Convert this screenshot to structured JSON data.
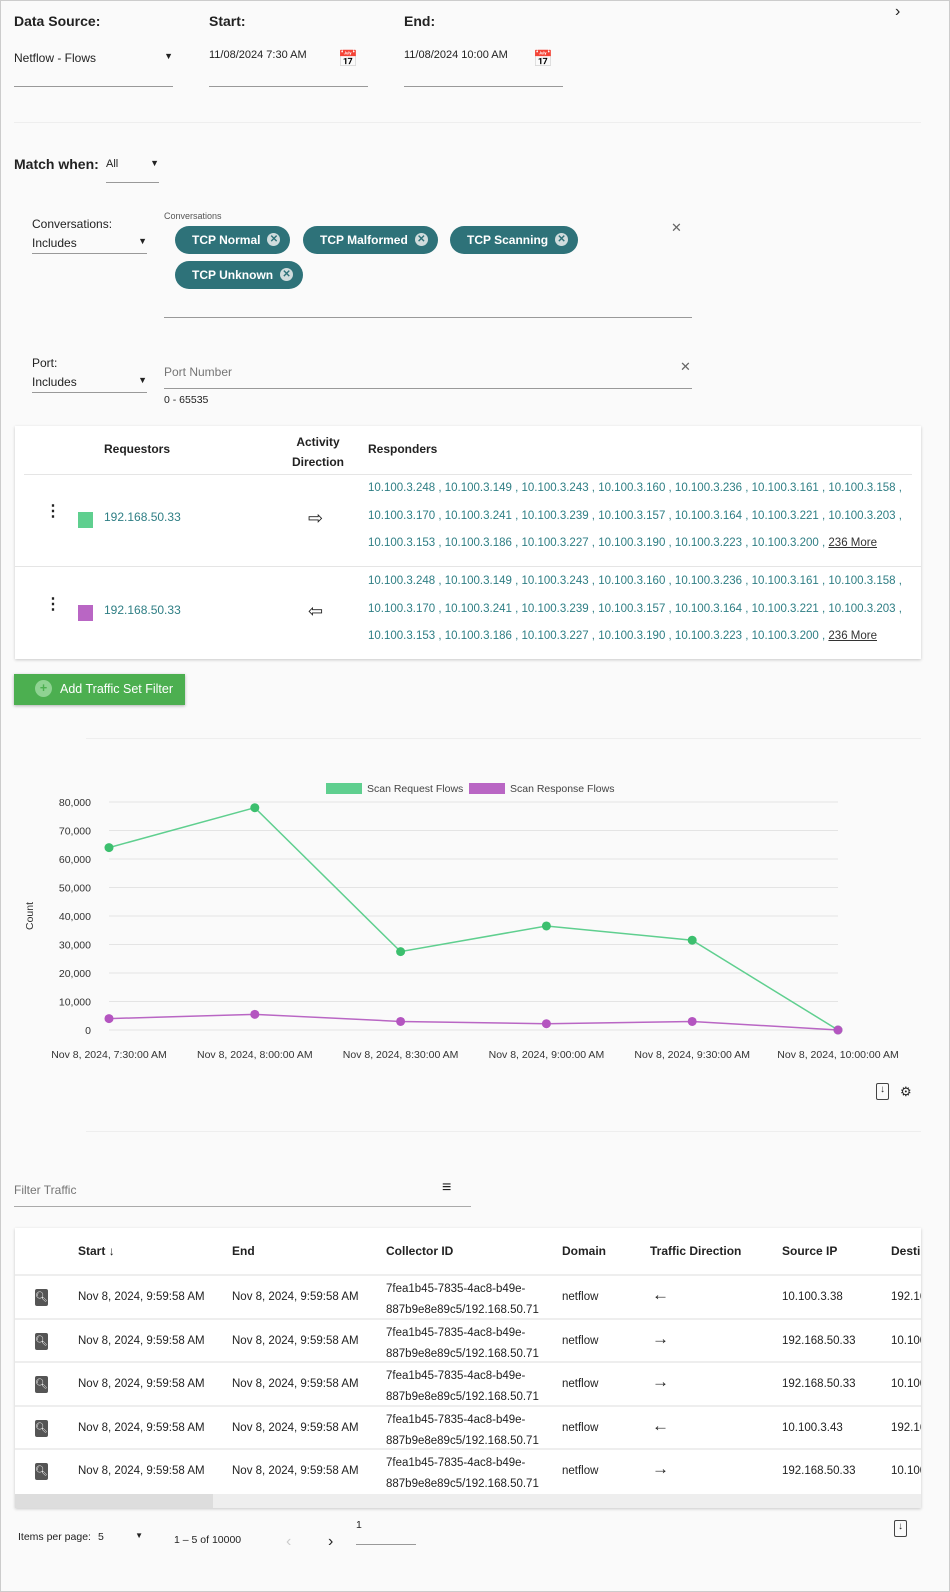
{
  "filters": {
    "data_source_label": "Data Source:",
    "data_source": "Netflow - Flows",
    "start_label": "Start:",
    "start": "11/08/2024 7:30 AM",
    "end_label": "End:",
    "end": "11/08/2024 10:00 AM",
    "match_label": "Match when:",
    "match": "All"
  },
  "conversations": {
    "label": "Conversations:",
    "mode": "Includes",
    "field_label": "Conversations",
    "chips": [
      "TCP Normal",
      "TCP Malformed",
      "TCP Scanning",
      "TCP Unknown"
    ]
  },
  "port": {
    "label": "Port:",
    "mode": "Includes",
    "placeholder": "Port Number",
    "hint": "0 - 65535"
  },
  "traffic_sets": {
    "headers": {
      "requestors": "Requestors",
      "activity1": "Activity",
      "activity2": "Direction",
      "responders": "Responders"
    },
    "rows": [
      {
        "requestor": "192.168.50.33",
        "color": "#5fcf8f",
        "direction": "right",
        "responders": "10.100.3.248 , 10.100.3.149 , 10.100.3.243 , 10.100.3.160 , 10.100.3.236 , 10.100.3.161 , 10.100.3.158 , 10.100.3.170 , 10.100.3.241 , 10.100.3.239 , 10.100.3.157 , 10.100.3.164 , 10.100.3.221 , 10.100.3.203 , 10.100.3.153 , 10.100.3.186 , 10.100.3.227 , 10.100.3.190 , 10.100.3.223 , 10.100.3.200 ,",
        "more": "236 More"
      },
      {
        "requestor": "192.168.50.33",
        "color": "#b966c4",
        "direction": "left",
        "responders": "10.100.3.248 , 10.100.3.149 , 10.100.3.243 , 10.100.3.160 , 10.100.3.236 , 10.100.3.161 , 10.100.3.158 , 10.100.3.170 , 10.100.3.241 , 10.100.3.239 , 10.100.3.157 , 10.100.3.164 , 10.100.3.221 , 10.100.3.203 , 10.100.3.153 , 10.100.3.186 , 10.100.3.227 , 10.100.3.190 , 10.100.3.223 , 10.100.3.200 ,",
        "more": "236 More"
      }
    ],
    "add_button": "Add Traffic Set Filter"
  },
  "chart_data": {
    "type": "line",
    "ylabel": "Count",
    "ylim": [
      0,
      80000
    ],
    "yticks": [
      "0",
      "10,000",
      "20,000",
      "30,000",
      "40,000",
      "50,000",
      "60,000",
      "70,000",
      "80,000"
    ],
    "categories": [
      "Nov 8, 2024, 7:30:00 AM",
      "Nov 8, 2024, 8:00:00 AM",
      "Nov 8, 2024, 8:30:00 AM",
      "Nov 8, 2024, 9:00:00 AM",
      "Nov 8, 2024, 9:30:00 AM",
      "Nov 8, 2024, 10:00:00 AM"
    ],
    "legend": "top",
    "grid": true,
    "series": [
      {
        "name": "Scan Request Flows",
        "color": "#5fcf8f",
        "values": [
          64000,
          78000,
          27500,
          36500,
          31500,
          0
        ]
      },
      {
        "name": "Scan Response Flows",
        "color": "#b966c4",
        "values": [
          4000,
          5500,
          3000,
          2200,
          3000,
          0
        ]
      }
    ]
  },
  "table": {
    "filter_placeholder": "Filter Traffic",
    "headers": [
      "Start",
      "End",
      "Collector ID",
      "Domain",
      "Traffic Direction",
      "Source IP",
      "Desti"
    ],
    "rows": [
      {
        "start": "Nov 8, 2024, 9:59:58 AM",
        "end": "Nov 8, 2024, 9:59:58 AM",
        "c1": "7fea1b45-7835-4ac8-b49e-",
        "c2": "887b9e8e89c5/192.168.50.71",
        "domain": "netflow",
        "dir": "←",
        "src": "10.100.3.38",
        "dst": "192.16"
      },
      {
        "start": "Nov 8, 2024, 9:59:58 AM",
        "end": "Nov 8, 2024, 9:59:58 AM",
        "c1": "7fea1b45-7835-4ac8-b49e-",
        "c2": "887b9e8e89c5/192.168.50.71",
        "domain": "netflow",
        "dir": "→",
        "src": "192.168.50.33",
        "dst": "10.100"
      },
      {
        "start": "Nov 8, 2024, 9:59:58 AM",
        "end": "Nov 8, 2024, 9:59:58 AM",
        "c1": "7fea1b45-7835-4ac8-b49e-",
        "c2": "887b9e8e89c5/192.168.50.71",
        "domain": "netflow",
        "dir": "→",
        "src": "192.168.50.33",
        "dst": "10.100"
      },
      {
        "start": "Nov 8, 2024, 9:59:58 AM",
        "end": "Nov 8, 2024, 9:59:58 AM",
        "c1": "7fea1b45-7835-4ac8-b49e-",
        "c2": "887b9e8e89c5/192.168.50.71",
        "domain": "netflow",
        "dir": "←",
        "src": "10.100.3.43",
        "dst": "192.16"
      },
      {
        "start": "Nov 8, 2024, 9:59:58 AM",
        "end": "Nov 8, 2024, 9:59:58 AM",
        "c1": "7fea1b45-7835-4ac8-b49e-",
        "c2": "887b9e8e89c5/192.168.50.71",
        "domain": "netflow",
        "dir": "→",
        "src": "192.168.50.33",
        "dst": "10.100"
      }
    ]
  },
  "paginator": {
    "items_label": "Items per page:",
    "items": "5",
    "range": "1 – 5 of 10000",
    "page": "1"
  }
}
